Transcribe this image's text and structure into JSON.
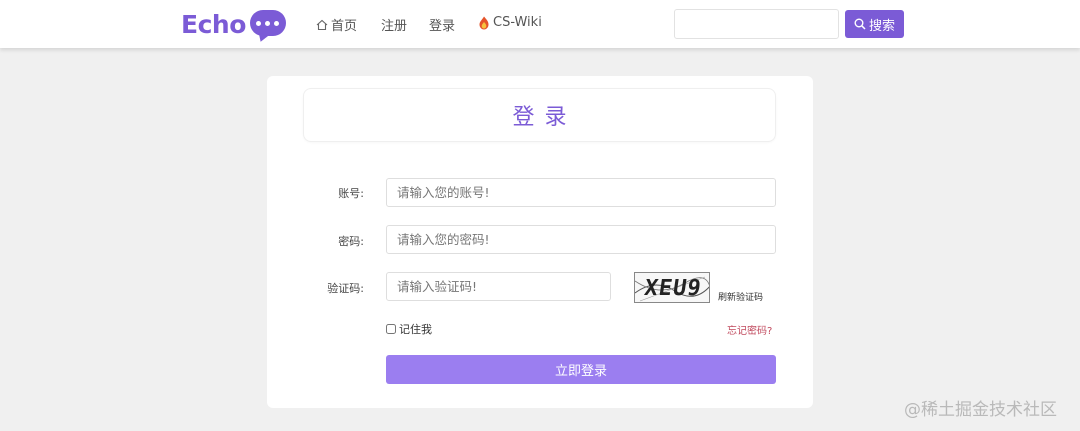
{
  "colors": {
    "brand": "#7b5bd6",
    "login_button": "#9b7ef0",
    "forgot_link": "#c0485c",
    "background": "#f0f0f0"
  },
  "navbar": {
    "brand": "Echo",
    "links": [
      {
        "label": "首页",
        "icon": "home-icon"
      },
      {
        "label": "注册"
      },
      {
        "label": "登录"
      },
      {
        "label": "CS-Wiki",
        "icon": "flame-icon"
      }
    ],
    "search": {
      "value": "",
      "button_label": "搜索",
      "icon": "search-icon"
    }
  },
  "login_form": {
    "title": "登录",
    "account": {
      "label": "账号:",
      "placeholder": "请输入您的账号!",
      "value": ""
    },
    "password": {
      "label": "密码:",
      "placeholder": "请输入您的密码!",
      "value": ""
    },
    "captcha": {
      "label": "验证码:",
      "placeholder": "请输入验证码!",
      "value": "",
      "image_text": "XEU9",
      "refresh_label": "刷新验证码"
    },
    "remember_me": {
      "label": "记住我",
      "checked": false
    },
    "forgot_password": "忘记密码?",
    "submit_label": "立即登录"
  },
  "watermark": "@稀土掘金技术社区"
}
